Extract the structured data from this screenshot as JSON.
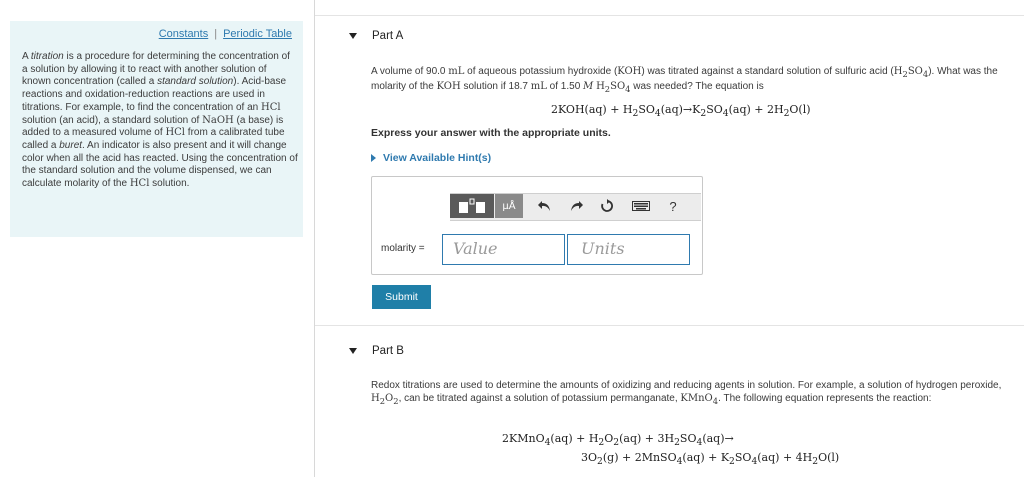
{
  "sidebar": {
    "links": {
      "constants": "Constants",
      "separator": "|",
      "periodic_table": "Periodic Table"
    },
    "intro": {
      "t1": "A ",
      "t2": "titration",
      "t3": " is a procedure for determining the concentration of a solution by allowing it to react with another solution of known concentration (called a ",
      "t4": "standard solution",
      "t5": "). Acid-base reactions and oxidation-reduction reactions are used in titrations. For example, to find the concentration of an ",
      "m1": "HCl",
      "t6": " solution (an acid), a standard solution of ",
      "m2": "NaOH",
      "t7": " (a base) is added to a measured volume of ",
      "m3": "HCl",
      "t8": " from a calibrated tube called a ",
      "t9": "buret",
      "t10": ". An indicator is also present and it will change color when all the acid has reacted. Using the concentration of the standard solution and the volume dispensed, we can calculate molarity of the ",
      "m4": "HCl",
      "t11": " solution."
    }
  },
  "partA": {
    "title": "Part A",
    "question": {
      "t1": "A volume of 90.0 ",
      "m1": "mL",
      "t2": " of aqueous potassium hydroxide (",
      "m2": "KOH",
      "t3": ") was titrated against a standard solution of sulfuric acid (",
      "m3a": "H",
      "m3s1": "2",
      "m3b": "SO",
      "m3s2": "4",
      "t4": "). What was the molarity of the ",
      "m4": "KOH",
      "t5": " solution if 18.7 ",
      "m5": "mL",
      "t6": " of 1.50 ",
      "m6": "M",
      "t7": " ",
      "m7a": "H",
      "m7s1": "2",
      "m7b": "SO",
      "m7s2": "4",
      "t8": " was needed? The equation is"
    },
    "equation": {
      "p1": "2KOH(aq) + H",
      "s1": "2",
      "p2": "SO",
      "s2": "4",
      "p3": "(aq)→K",
      "s3": "2",
      "p4": "SO",
      "s4": "4",
      "p5": "(aq) + 2H",
      "s5": "2",
      "p6": "O(l)"
    },
    "instruction": "Express your answer with the appropriate units.",
    "hints_link": "View Available Hint(s)",
    "toolbar": {
      "mu_label": "μÅ",
      "help_label": "?",
      "icons": [
        "templates-icon",
        "units-icon",
        "undo-icon",
        "redo-icon",
        "reset-icon",
        "keyboard-icon",
        "help-icon"
      ]
    },
    "answer": {
      "label": "molarity =",
      "value_placeholder": "Value",
      "units_placeholder": "Units"
    },
    "submit_label": "Submit"
  },
  "partB": {
    "title": "Part B",
    "question": {
      "t1": "Redox titrations are used to determine the amounts of oxidizing and reducing agents in solution. For example, a solution of hydrogen peroxide, ",
      "m1a": "H",
      "m1s1": "2",
      "m1b": "O",
      "m1s2": "2",
      "t2": ", can be titrated against a solution of potassium permanganate, ",
      "m2a": "KMnO",
      "m2s": "4",
      "t3": ". The following equation represents the reaction:"
    },
    "equation_line1": {
      "p1": "2KMnO",
      "s1": "4",
      "p2": "(aq) + H",
      "s2": "2",
      "p3": "O",
      "s3": "2",
      "p4": "(aq) + 3H",
      "s4": "2",
      "p5": "SO",
      "s5": "4",
      "p6": "(aq)→"
    },
    "equation_line2": {
      "p1": "3O",
      "s1": "2",
      "p2": "(g) + 2MnSO",
      "s2": "4",
      "p3": "(aq) + K",
      "s3": "2",
      "p4": "SO",
      "s4": "4",
      "p5": "(aq) + 4H",
      "s5": "2",
      "p6": "O(l)"
    }
  },
  "colors": {
    "link": "#2f7aaf",
    "sidebar_bg": "#e9f5f7",
    "submit_bg": "#1f7fa8",
    "field_border": "#2f7aaf",
    "toolbar_dark": "#5a5a5a"
  }
}
